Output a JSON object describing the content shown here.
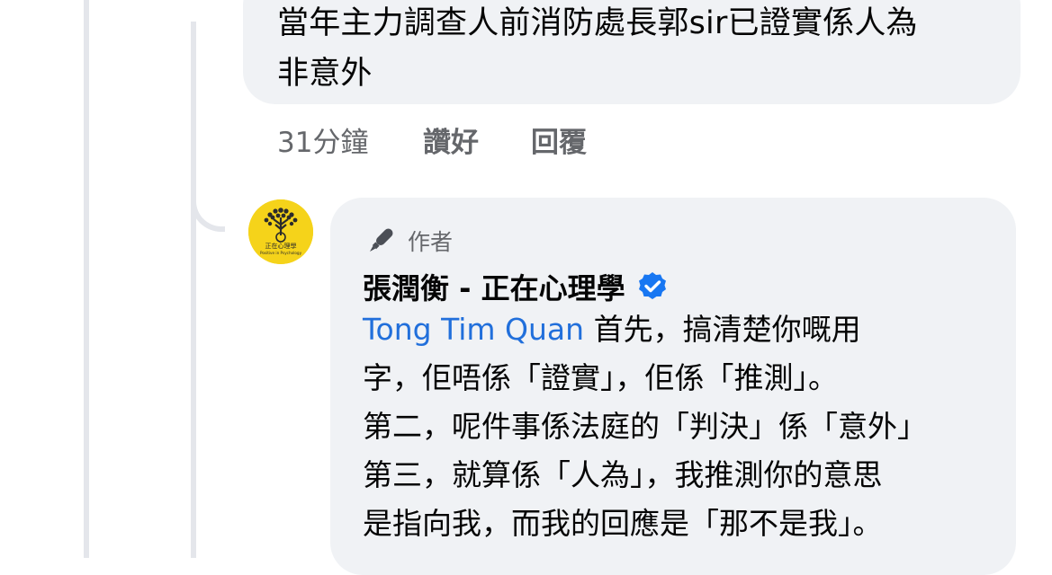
{
  "previous_comment": {
    "text_line1": "當年主力調查人前消防處長郭sir已證實係人為",
    "text_line2": "非意外",
    "time": "31分鐘",
    "like_label": "讚好",
    "reply_label": "回覆"
  },
  "author_reply": {
    "author_badge": "作者",
    "author_badge_icon": "pen-icon",
    "name": "張潤衡 - 正在心理學",
    "verified_icon": "verified-badge-icon",
    "verified_color": "#1877f2",
    "mention": "Tong Tim Quan",
    "line1_rest": " 首先，搞清楚你嘅用",
    "line2": "字，佢唔係「證實」，佢係「推測」。",
    "line3": "第二，呢件事係法庭的「判決」係「意外」",
    "line4": "第三，就算係「人為」，我推測你的意思",
    "line5": "是指向我，而我的回應是「那不是我」。",
    "avatar_text_cn": "正在心理學",
    "avatar_text_en": "Positive in Psychology",
    "avatar_color": "#f5d31a"
  }
}
